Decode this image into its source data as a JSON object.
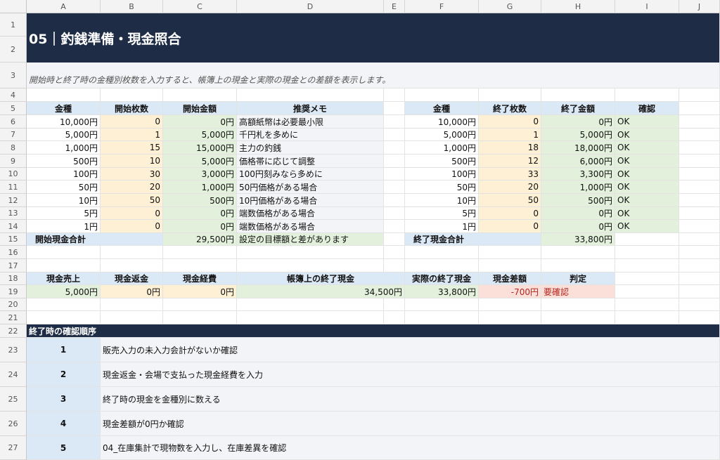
{
  "columns": [
    "A",
    "B",
    "C",
    "D",
    "E",
    "F",
    "G",
    "H",
    "I",
    "J"
  ],
  "rows": [
    "1",
    "2",
    "3",
    "4",
    "5",
    "6",
    "7",
    "8",
    "9",
    "10",
    "11",
    "12",
    "13",
    "14",
    "15",
    "16",
    "17",
    "18",
    "19",
    "20",
    "21",
    "22",
    "23",
    "24",
    "25",
    "26",
    "27"
  ],
  "title": "05｜釣銭準備・現金照合",
  "subtitle": "開始時と終了時の金種別枚数を入力すると、帳簿上の現金と実際の現金との差額を表示します。",
  "start_table": {
    "headers": [
      "金種",
      "開始枚数",
      "開始金額",
      "推奨メモ"
    ],
    "rows": [
      {
        "denom": "10,000円",
        "count": "0",
        "amount": "0円",
        "memo": "高額紙幣は必要最小限"
      },
      {
        "denom": "5,000円",
        "count": "1",
        "amount": "5,000円",
        "memo": "千円札を多めに"
      },
      {
        "denom": "1,000円",
        "count": "15",
        "amount": "15,000円",
        "memo": "主力の釣銭"
      },
      {
        "denom": "500円",
        "count": "10",
        "amount": "5,000円",
        "memo": "価格帯に応じて調整"
      },
      {
        "denom": "100円",
        "count": "30",
        "amount": "3,000円",
        "memo": "100円刻みなら多めに"
      },
      {
        "denom": "50円",
        "count": "20",
        "amount": "1,000円",
        "memo": "50円価格がある場合"
      },
      {
        "denom": "10円",
        "count": "50",
        "amount": "500円",
        "memo": "10円価格がある場合"
      },
      {
        "denom": "5円",
        "count": "0",
        "amount": "0円",
        "memo": "端数価格がある場合"
      },
      {
        "denom": "1円",
        "count": "0",
        "amount": "0円",
        "memo": "端数価格がある場合"
      }
    ],
    "total_label": "開始現金合計",
    "total_value": "29,500円",
    "total_note": "設定の目標額と差があります"
  },
  "end_table": {
    "headers": [
      "金種",
      "終了枚数",
      "終了金額",
      "確認"
    ],
    "rows": [
      {
        "denom": "10,000円",
        "count": "0",
        "amount": "0円",
        "check": "OK"
      },
      {
        "denom": "5,000円",
        "count": "1",
        "amount": "5,000円",
        "check": "OK"
      },
      {
        "denom": "1,000円",
        "count": "18",
        "amount": "18,000円",
        "check": "OK"
      },
      {
        "denom": "500円",
        "count": "12",
        "amount": "6,000円",
        "check": "OK"
      },
      {
        "denom": "100円",
        "count": "33",
        "amount": "3,300円",
        "check": "OK"
      },
      {
        "denom": "50円",
        "count": "20",
        "amount": "1,000円",
        "check": "OK"
      },
      {
        "denom": "10円",
        "count": "50",
        "amount": "500円",
        "check": "OK"
      },
      {
        "denom": "5円",
        "count": "0",
        "amount": "0円",
        "check": "OK"
      },
      {
        "denom": "1円",
        "count": "0",
        "amount": "0円",
        "check": "OK"
      }
    ],
    "total_label": "終了現金合計",
    "total_value": "33,800円"
  },
  "summary": {
    "headers": [
      "現金売上",
      "現金返金",
      "現金経費",
      "帳簿上の終了現金",
      "実際の終了現金",
      "現金差額",
      "判定"
    ],
    "values": [
      "5,000円",
      "0円",
      "0円",
      "34,500円",
      "33,800円",
      "-700円",
      "要確認"
    ]
  },
  "steps_title": "終了時の確認順序",
  "steps": [
    {
      "num": "1",
      "text": "販売入力の未入力会計がないか確認"
    },
    {
      "num": "2",
      "text": "現金返金・会場で支払った現金経費を入力"
    },
    {
      "num": "3",
      "text": "終了時の現金を金種別に数える"
    },
    {
      "num": "4",
      "text": "現金差額が0円か確認"
    },
    {
      "num": "5",
      "text": "04_在庫集計で現物数を入力し、在庫差異を確認"
    }
  ],
  "colors": {
    "navy": "#1e2d45",
    "header_blue": "#dbe8f6",
    "input_tan": "#fdf0d4",
    "calc_green": "#e3f1dc",
    "alert_pink": "#fbe0da"
  }
}
